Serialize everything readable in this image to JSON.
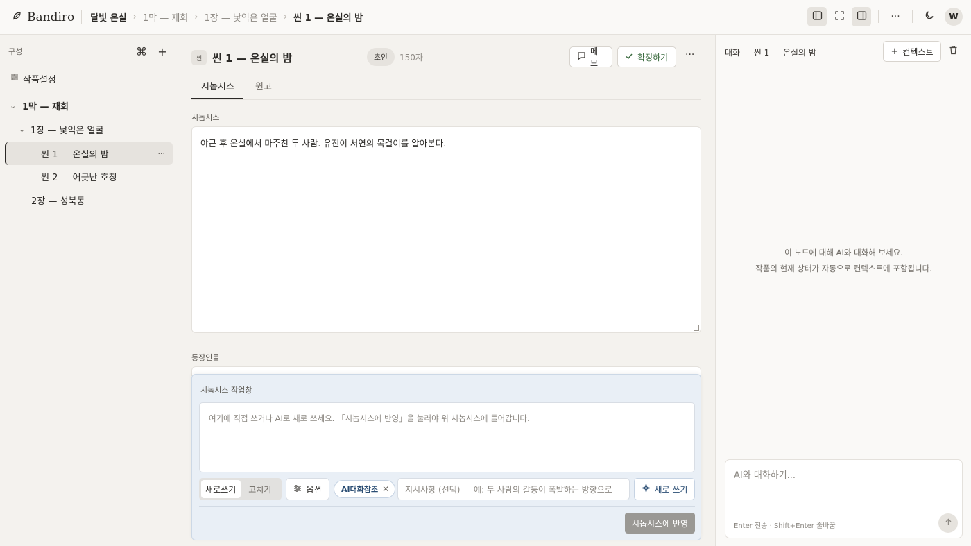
{
  "topbar": {
    "brand": "Bandiro",
    "breadcrumbs": [
      "달빛 온실",
      "1막 — 재회",
      "1장 — 낯익은 얼굴",
      "씬 1 — 온실의 밤"
    ],
    "icons": [
      "feather-logo-icon",
      "sidebar-left-icon",
      "fullscreen-icon",
      "sidebar-right-icon",
      "more-icon",
      "moon-icon"
    ],
    "avatar": "W"
  },
  "sidebar": {
    "title": "구성",
    "items": [
      {
        "label": "작품설정",
        "level": 0,
        "icon": "settings-sliders-icon"
      },
      {
        "label": "1막 — 재회",
        "level": 0,
        "expanded": true
      },
      {
        "label": "1장 — 낯익은 얼굴",
        "level": 1,
        "expanded": true
      },
      {
        "label": "씬 1 — 온실의 밤",
        "level": 2,
        "selected": true
      },
      {
        "label": "씬 2 — 어긋난 호칭",
        "level": 2
      },
      {
        "label": "2장 — 성북동",
        "level": 1
      }
    ],
    "more": "···"
  },
  "main": {
    "badge": "씬",
    "title": "씬 1 — 온실의 밤",
    "status": "초안",
    "char_count": "150자",
    "memo_label": "메모",
    "confirm_label": "확정하기",
    "more": "···",
    "tabs": [
      {
        "label": "시놉시스",
        "active": true
      },
      {
        "label": "원고",
        "active": false
      }
    ],
    "synopsis_label": "시놉시스",
    "synopsis_text": "야근 후 온실에서 마주친 두 사람. 유진이 서연의 목걸이를 알아본다.",
    "characters_label": "등장인물"
  },
  "workpanel": {
    "title": "시놉시스 작업창",
    "placeholder": "여기에 직접 쓰거나 AI로 새로 쓰세요. 「시놉시스에 반영」을 눌러야 위 시놉시스에 들어갑니다.",
    "mode_write": "새로쓰기",
    "mode_edit": "고치기",
    "options_label": "옵션",
    "chip_label": "AI대화참조",
    "instruction_placeholder": "지시사항 (선택) — 예: 두 사람의 갈등이 폭발하는 방향으로",
    "rewrite_label": "새로 쓰기",
    "apply_label": "시놉시스에 반영"
  },
  "rightpanel": {
    "title": "대화 — 씬 1 — 온실의 밤",
    "context_label": "컨텍스트",
    "empty_line1": "이 노드에 대해 AI와 대화해 보세요.",
    "empty_line2": "작품의 현재 상태가 자동으로 컨텍스트에 포함됩니다.",
    "chat_placeholder": "AI와 대화하기...",
    "chat_hint": "Enter 전송 · Shift+Enter 줄바꿈"
  }
}
